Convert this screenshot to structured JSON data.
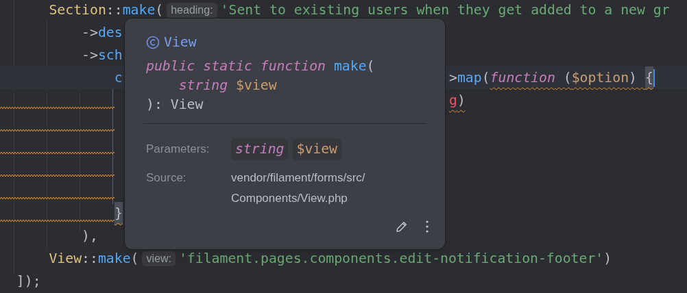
{
  "editor": {
    "lines": [
      {
        "segments": [
          {
            "text": "      Section",
            "kind": "class"
          },
          {
            "text": "::",
            "kind": "plain"
          },
          {
            "text": "make",
            "kind": "method"
          },
          {
            "text": "(",
            "kind": "plain"
          },
          {
            "text": "heading:",
            "kind": "hint"
          },
          {
            "text": "'Sent to existing users when they get added to a new gr",
            "kind": "string"
          }
        ]
      },
      {
        "segments": [
          {
            "text": "          ->",
            "kind": "plain"
          },
          {
            "text": "des",
            "kind": "method"
          }
        ]
      },
      {
        "segments": [
          {
            "text": "          ->",
            "kind": "plain"
          },
          {
            "text": "sch",
            "kind": "method"
          }
        ]
      },
      {
        "current": true,
        "segments": [
          {
            "text": "              c",
            "kind": "method"
          },
          {
            "text": ">",
            "kind": "plain",
            "covered_before": true
          },
          {
            "text": "map",
            "kind": "method"
          },
          {
            "text": "(",
            "kind": "plain"
          },
          {
            "text": "function",
            "kind": "keyword",
            "warning": true
          },
          {
            "text": " (",
            "kind": "plain",
            "warning": true
          },
          {
            "text": "$option",
            "kind": "var",
            "warning": true
          },
          {
            "text": ") ",
            "kind": "plain",
            "warning": true
          },
          {
            "text": "{",
            "kind": "plain",
            "warning": true,
            "matched": true,
            "caret": true
          }
        ]
      },
      {
        "warning": true,
        "segments": [
          {
            "text": "g",
            "kind": "error",
            "warning": true,
            "covered_before": true
          },
          {
            "text": ")",
            "kind": "plain",
            "warning": true
          }
        ]
      },
      {
        "warning": true
      },
      {
        "warning": true
      },
      {
        "warning": true
      },
      {
        "warning": true
      },
      {
        "warning": true,
        "segments": [
          {
            "text": "}",
            "kind": "plain",
            "matched": true,
            "warning": true
          }
        ]
      },
      {
        "segments": [
          {
            "text": "          ),",
            "kind": "plain"
          }
        ]
      },
      {
        "segments": [
          {
            "text": "      View",
            "kind": "class"
          },
          {
            "text": "::",
            "kind": "plain"
          },
          {
            "text": "make",
            "kind": "method"
          },
          {
            "text": "(",
            "kind": "plain"
          },
          {
            "text": "view:",
            "kind": "hint"
          },
          {
            "text": "'filament.pages.components.edit-notification-footer'",
            "kind": "string"
          },
          {
            "text": ")",
            "kind": "plain"
          }
        ]
      },
      {
        "segments": [
          {
            "text": "  ]);",
            "kind": "plain"
          }
        ]
      }
    ]
  },
  "popup": {
    "title": "View",
    "signature": [
      [
        {
          "text": "public static function ",
          "kind": "keyword"
        },
        {
          "text": "make",
          "kind": "method"
        },
        {
          "text": "(",
          "kind": "plain"
        }
      ],
      [
        {
          "text": "    string ",
          "kind": "keyword"
        },
        {
          "text": "$view",
          "kind": "var"
        }
      ],
      [
        {
          "text": "): View",
          "kind": "plain"
        }
      ]
    ],
    "parameters_label": "Parameters:",
    "parameters": [
      {
        "text": "string",
        "kind": "keyword"
      },
      {
        "text": "$view",
        "kind": "var"
      }
    ],
    "source_label": "Source:",
    "source": [
      "vendor/filament/forms/src/",
      "Components/View.php"
    ]
  }
}
